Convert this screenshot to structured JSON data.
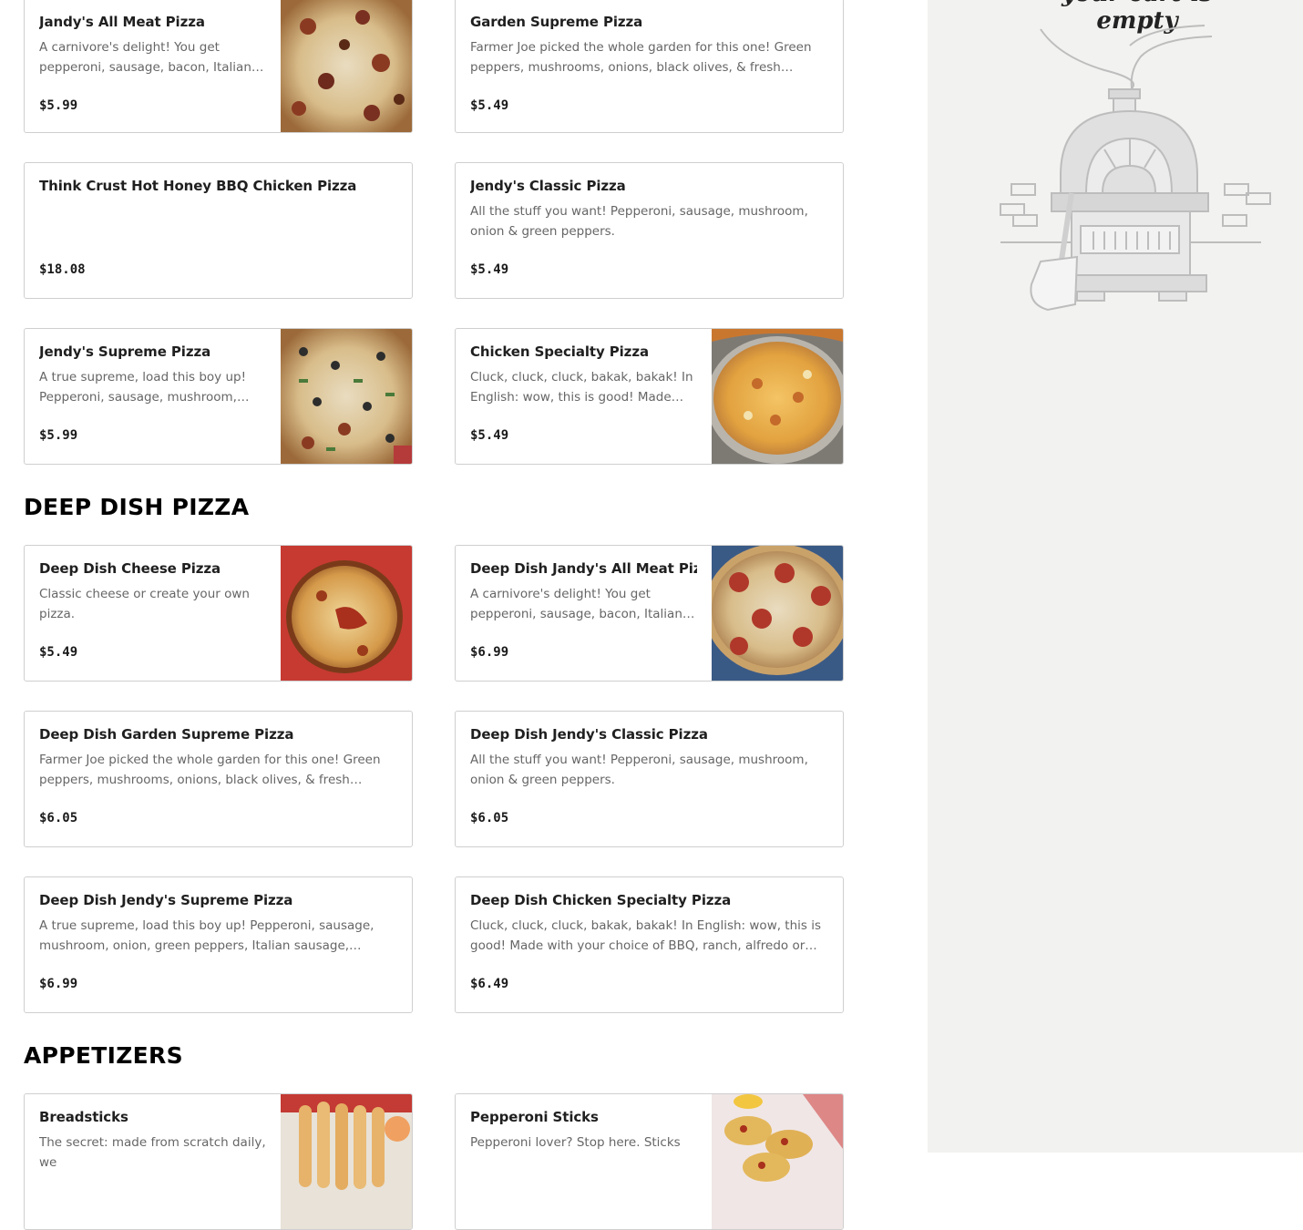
{
  "cart": {
    "empty_message": "your cart is empty",
    "illustration": "pizza-oven-illustration"
  },
  "sections": {
    "deep_dish_title": "DEEP DISH PIZZA",
    "appetizers_title": "APPETIZERS"
  },
  "items": [
    {
      "name": "Jandy's All Meat Pizza",
      "desc": "A carnivore's delight! You get pepperoni, sausage, bacon, Italian…",
      "price": "$5.99",
      "image": "all-meat-pizza-photo"
    },
    {
      "name": "Garden Supreme Pizza",
      "desc": "Farmer Joe picked the whole garden for this one! Green peppers, mushrooms, onions, black olives, & fresh tomatoes.",
      "price": "$5.49"
    },
    {
      "name": "Think Crust Hot Honey BBQ Chicken Pizza",
      "desc": "",
      "price": "$18.08"
    },
    {
      "name": "Jendy's Classic Pizza",
      "desc": "All the stuff you want! Pepperoni, sausage, mushroom, onion & green peppers.",
      "price": "$5.49"
    },
    {
      "name": "Jendy's Supreme Pizza",
      "desc": "A true supreme, load this boy up! Pepperoni, sausage, mushroom, onio…",
      "price": "$5.99",
      "image": "supreme-pizza-photo"
    },
    {
      "name": "Chicken Specialty Pizza",
      "desc": "Cluck, cluck, cluck, bakak, bakak! In English: wow, this is good! Made with…",
      "price": "$5.49",
      "image": "chicken-pizza-photo"
    },
    {
      "name": "Deep Dish Cheese Pizza",
      "desc": "Classic cheese or create your own pizza.",
      "price": "$5.49",
      "image": "deep-dish-cheese-photo"
    },
    {
      "name": "Deep Dish Jandy's All Meat Pizza",
      "desc": "A carnivore's delight! You get pepperoni, sausage, bacon, Italian…",
      "price": "$6.99",
      "image": "deep-dish-all-meat-photo"
    },
    {
      "name": "Deep Dish Garden Supreme Pizza",
      "desc": "Farmer Joe picked the whole garden for this one! Green peppers, mushrooms, onions, black olives, & fresh tomatoes.",
      "price": "$6.05"
    },
    {
      "name": "Deep Dish Jendy's Classic Pizza",
      "desc": "All the stuff you want! Pepperoni, sausage, mushroom, onion & green peppers.",
      "price": "$6.05"
    },
    {
      "name": "Deep Dish Jendy's Supreme Pizza",
      "desc": "A true supreme, load this boy up! Pepperoni, sausage, mushroom, onion, green peppers, Italian sausage, bacon,…",
      "price": "$6.99"
    },
    {
      "name": "Deep Dish Chicken Specialty Pizza",
      "desc": "Cluck, cluck, cluck, bakak, bakak! In English: wow, this is good! Made with your choice of BBQ, ranch, alfredo or buffal…",
      "price": "$6.49"
    },
    {
      "name": "Breadsticks",
      "desc": "The secret: made from scratch daily, we",
      "price": "",
      "image": "breadsticks-photo"
    },
    {
      "name": "Pepperoni Sticks",
      "desc": "Pepperoni lover? Stop here. Sticks",
      "price": "",
      "image": "pepperoni-sticks-photo"
    }
  ]
}
